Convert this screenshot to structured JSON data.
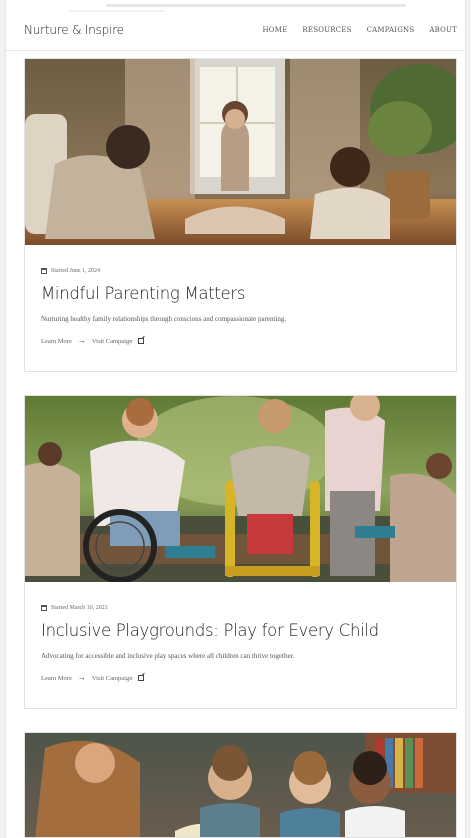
{
  "brand": {
    "name": "Nurture & Inspire"
  },
  "nav": {
    "items": [
      "HOME",
      "RESOURCES",
      "CAMPAIGNS",
      "ABOUT"
    ]
  },
  "cards": [
    {
      "started": "Started June 1, 2024",
      "title": "Mindful Parenting Matters",
      "description": "Nurturing healthy family relationships through conscious and compassionate parenting.",
      "learn_more": "Learn More",
      "visit": "Visit Campaign"
    },
    {
      "started": "Started March 10, 2023",
      "title": "Inclusive Playgrounds: Play for Every Child",
      "description": "Advocating for accessible and inclusive play spaces where all children can thrive together.",
      "learn_more": "Learn More",
      "visit": "Visit Campaign"
    }
  ],
  "colors": {
    "page_background": "#ffffff",
    "outer_background": "#f2f2f2",
    "text_dark": "#1f1f1f",
    "text_muted": "#666666",
    "border": "#e2e2e2"
  }
}
